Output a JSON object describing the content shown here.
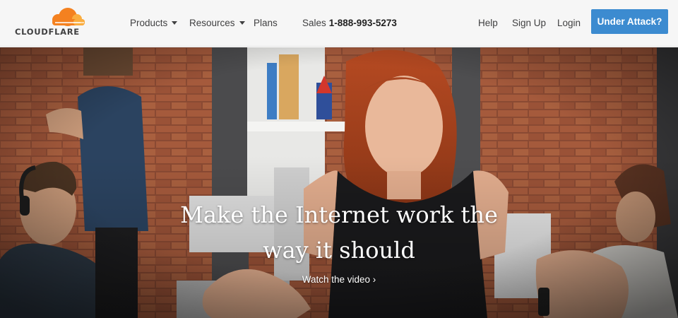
{
  "header": {
    "logo_text": "CLOUDFLARE",
    "nav": {
      "products": "Products",
      "resources": "Resources",
      "plans": "Plans"
    },
    "sales": {
      "label": "Sales",
      "phone": "1-888-993-5273"
    },
    "help": "Help",
    "signup": "Sign Up",
    "login": "Login",
    "attack_button": "Under Attack?"
  },
  "hero": {
    "title_line1": "Make the Internet work the",
    "title_line2": "way it should",
    "watch_link": "Watch the video ›"
  },
  "colors": {
    "brand_orange": "#f48120",
    "brand_orange_light": "#faad3f",
    "button_blue": "#3c8bd0",
    "header_bg": "#f6f6f6",
    "nav_text": "#404041"
  }
}
